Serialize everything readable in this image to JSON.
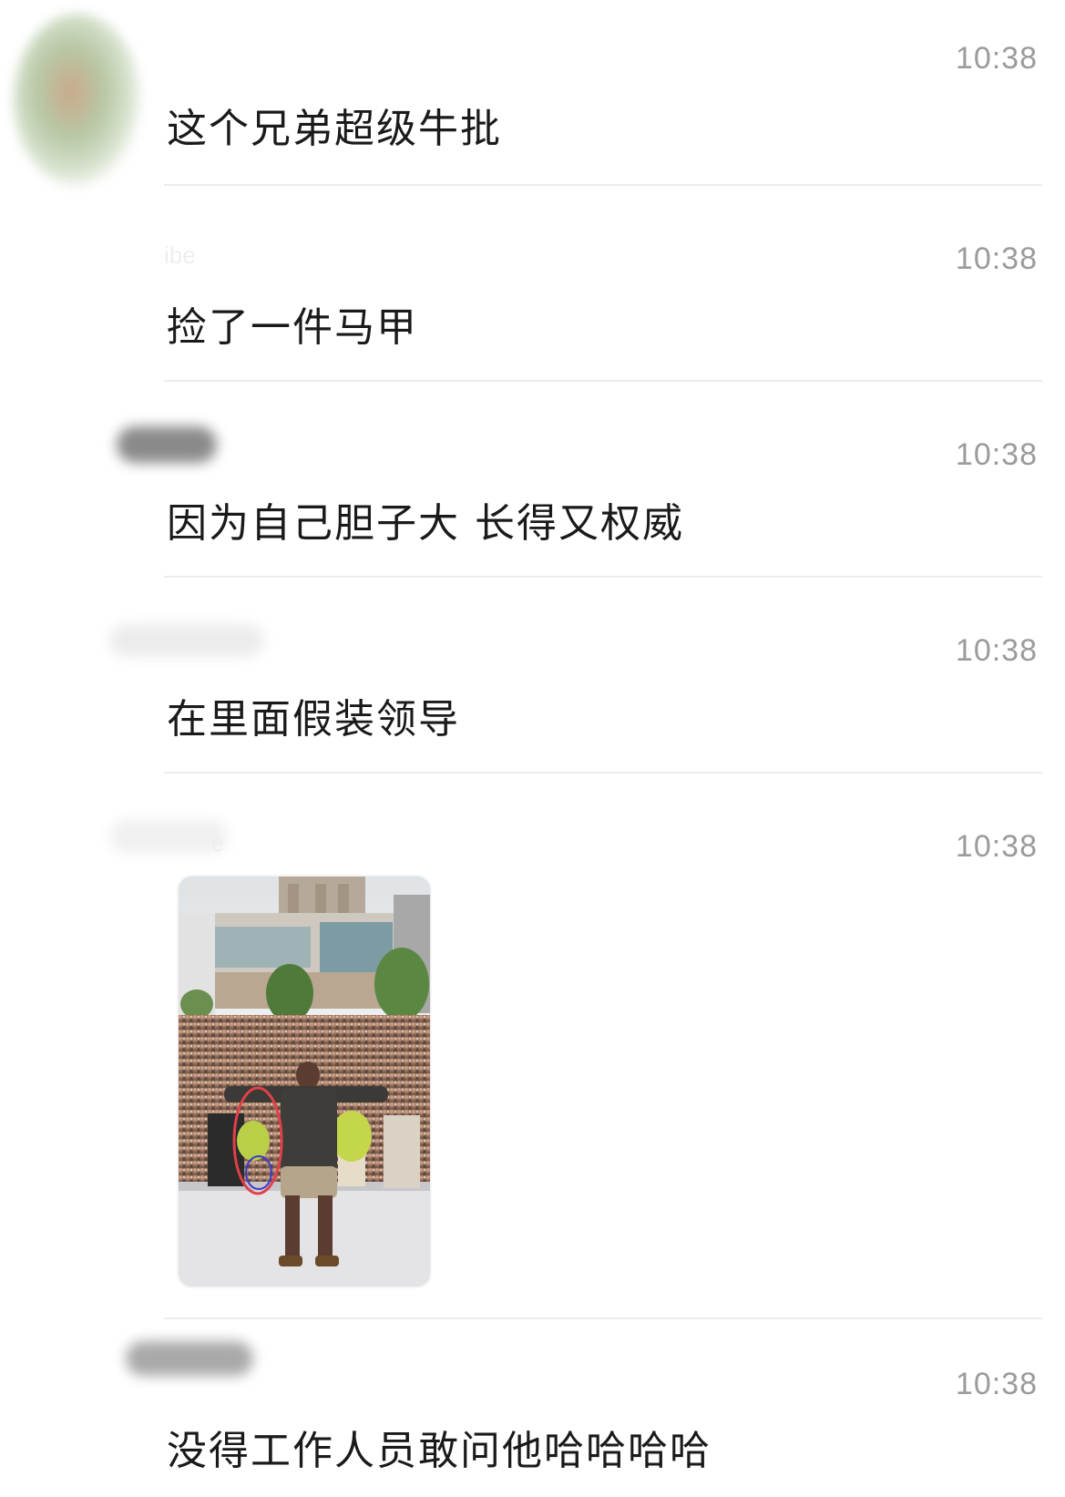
{
  "messages": [
    {
      "time": "10:38",
      "text": "这个兄弟超级牛批"
    },
    {
      "time": "10:38",
      "text": "捡了一件马甲",
      "name_fragment": "ibe"
    },
    {
      "time": "10:38",
      "text": "因为自己胆子大 长得又权威"
    },
    {
      "time": "10:38",
      "text": "在里面假装领导"
    },
    {
      "time": "10:38",
      "name_fragment": "e",
      "image": "crowd-photo-with-circled-vest"
    },
    {
      "time": "10:38",
      "text": "没得工作人员敢问他哈哈哈哈"
    }
  ],
  "colors": {
    "background": "#ffffff",
    "text": "#1a1a1a",
    "timestamp": "#9b9b9b",
    "divider": "#ececec",
    "annotation_circle": "#e0404a",
    "annotation_circle_inner": "#3a3ad0"
  }
}
